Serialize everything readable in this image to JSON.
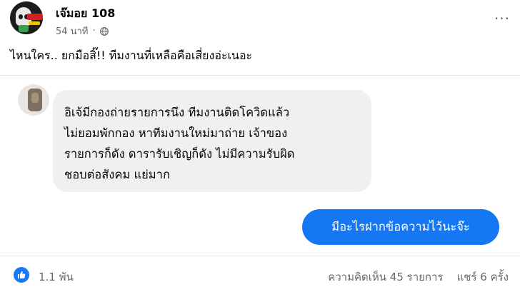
{
  "post": {
    "author": "เจ๊มอย 108",
    "time": "54 นาที",
    "separator": "·",
    "privacy_icon": "globe-icon",
    "more_icon": "ellipsis-icon",
    "more_glyph": "···",
    "caption": "ไหนใคร.. ยกมือสิ๊!! ทีมงานที่เหลือคือเสี่ยงอ่ะเนอะ"
  },
  "chat": {
    "incoming_lines": [
      "อิเจ้มีกองถ่ายรายการนึง ทีมงานติดโควิดแล้ว",
      "ไม่ยอมพักกอง หาทีมงานใหม่มาถ่าย เจ้าของ",
      "รายการก็ดัง ดารารับเชิญก็ดัง ไม่มีความรับผิด",
      "ชอบต่อสังคม แย่มาก"
    ],
    "outgoing": "มีอะไรฝากข้อความไว้นะจ๊ะ"
  },
  "footer": {
    "reaction_icon": "like-icon",
    "reactions": "1.1 พัน",
    "comments": "ความคิดเห็น 45 รายการ",
    "shares": "แชร์ 6 ครั้ง"
  },
  "colors": {
    "accent": "#1877f2",
    "bubble_out": "#1677f2",
    "bubble_in": "#f0f0f0",
    "secondary_text": "#65676b"
  }
}
